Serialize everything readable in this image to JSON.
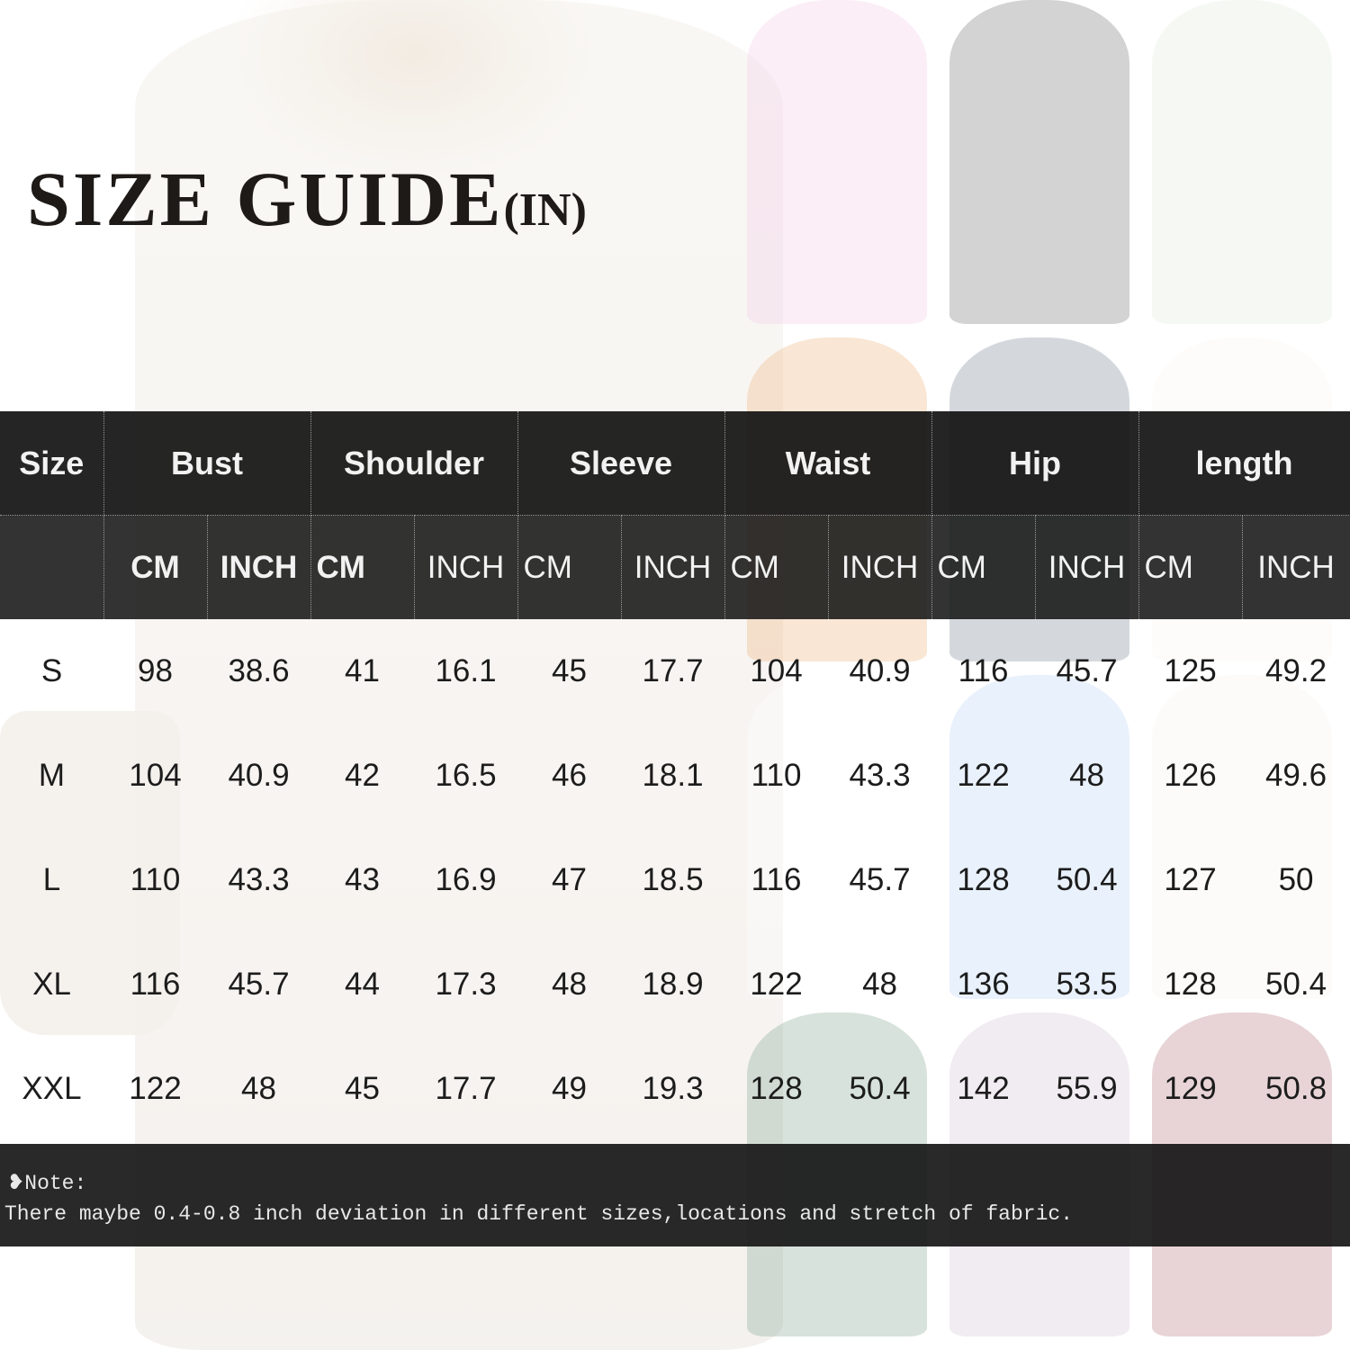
{
  "title": {
    "main": "SIZE GUIDE",
    "unit": "(IN)"
  },
  "columns": [
    "Size",
    "Bust",
    "Shoulder",
    "Sleeve",
    "Waist",
    "Hip",
    "length"
  ],
  "units": {
    "cm": "CM",
    "inch": "INCH"
  },
  "rows": [
    {
      "size": "S",
      "bust_cm": "98",
      "bust_in": "38.6",
      "shoulder_cm": "41",
      "shoulder_in": "16.1",
      "sleeve_cm": "45",
      "sleeve_in": "17.7",
      "waist_cm": "104",
      "waist_in": "40.9",
      "hip_cm": "116",
      "hip_in": "45.7",
      "length_cm": "125",
      "length_in": "49.2"
    },
    {
      "size": "M",
      "bust_cm": "104",
      "bust_in": "40.9",
      "shoulder_cm": "42",
      "shoulder_in": "16.5",
      "sleeve_cm": "46",
      "sleeve_in": "18.1",
      "waist_cm": "110",
      "waist_in": "43.3",
      "hip_cm": "122",
      "hip_in": "48",
      "length_cm": "126",
      "length_in": "49.6"
    },
    {
      "size": "L",
      "bust_cm": "110",
      "bust_in": "43.3",
      "shoulder_cm": "43",
      "shoulder_in": "16.9",
      "sleeve_cm": "47",
      "sleeve_in": "18.5",
      "waist_cm": "116",
      "waist_in": "45.7",
      "hip_cm": "128",
      "hip_in": "50.4",
      "length_cm": "127",
      "length_in": "50"
    },
    {
      "size": "XL",
      "bust_cm": "116",
      "bust_in": "45.7",
      "shoulder_cm": "44",
      "shoulder_in": "17.3",
      "sleeve_cm": "48",
      "sleeve_in": "18.9",
      "waist_cm": "122",
      "waist_in": "48",
      "hip_cm": "136",
      "hip_in": "53.5",
      "length_cm": "128",
      "length_in": "50.4"
    },
    {
      "size": "XXL",
      "bust_cm": "122",
      "bust_in": "48",
      "shoulder_cm": "45",
      "shoulder_in": "17.7",
      "sleeve_cm": "49",
      "sleeve_in": "19.3",
      "waist_cm": "128",
      "waist_in": "50.4",
      "hip_cm": "142",
      "hip_in": "55.9",
      "length_cm": "129",
      "length_in": "50.8"
    }
  ],
  "note": {
    "label": "❥Note:",
    "text": "There maybe 0.4-0.8 inch deviation in different sizes,locations and stretch of fabric."
  },
  "dress_colors": [
    "#e7a6d3",
    "#1a1a1a",
    "#cfe0c4",
    "#e07a1f",
    "#1f3350",
    "#f4efe6",
    "#ffffff",
    "#8fb8ef",
    "#f1ece2",
    "#2e6b47",
    "#b89ab8",
    "#8a1f2e"
  ]
}
